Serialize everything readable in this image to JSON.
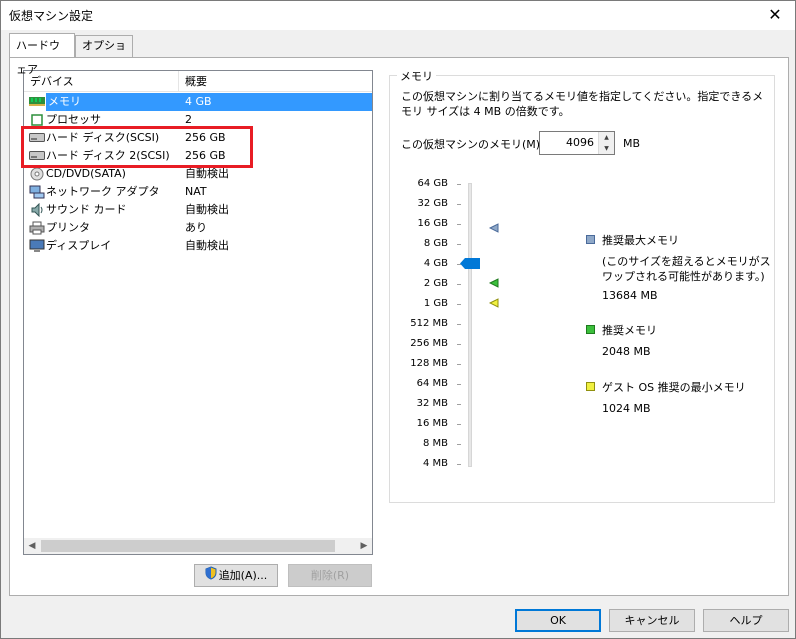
{
  "window": {
    "title": "仮想マシン設定",
    "close_glyph": "✕"
  },
  "tabs": [
    {
      "label": "ハードウェア",
      "active": true
    },
    {
      "label": "オプション",
      "active": false
    }
  ],
  "device_list": {
    "headers": {
      "device": "デバイス",
      "summary": "概要"
    },
    "rows": [
      {
        "icon": "memory-icon",
        "name": "メモリ",
        "value": "4 GB",
        "selected": true
      },
      {
        "icon": "processor-icon",
        "name": "プロセッサ",
        "value": "2",
        "selected": false
      },
      {
        "icon": "hard-disk-icon",
        "name": "ハード ディスク(SCSI)",
        "value": "256 GB",
        "selected": false
      },
      {
        "icon": "hard-disk-icon",
        "name": "ハード ディスク 2(SCSI)",
        "value": "256 GB",
        "selected": false
      },
      {
        "icon": "cd-dvd-icon",
        "name": "CD/DVD(SATA)",
        "value": "自動検出",
        "selected": false
      },
      {
        "icon": "network-adapter-icon",
        "name": "ネットワーク アダプタ",
        "value": "NAT",
        "selected": false
      },
      {
        "icon": "sound-card-icon",
        "name": "サウンド カード",
        "value": "自動検出",
        "selected": false
      },
      {
        "icon": "printer-icon",
        "name": "プリンタ",
        "value": "あり",
        "selected": false
      },
      {
        "icon": "display-icon",
        "name": "ディスプレイ",
        "value": "自動検出",
        "selected": false
      }
    ]
  },
  "buttons": {
    "add": "追加(A)...",
    "remove": "削除(R)",
    "ok": "OK",
    "cancel": "キャンセル",
    "help": "ヘルプ"
  },
  "memory": {
    "group_title": "メモリ",
    "description": "この仮想マシンに割り当てるメモリ値を指定してください。指定できるメモリ サイズは 4 MB の倍数です。",
    "field_label": "この仮想マシンのメモリ(M):",
    "value": "4096",
    "unit": "MB",
    "scale_labels": [
      "64 GB",
      "32 GB",
      "16 GB",
      "8 GB",
      "4 GB",
      "2 GB",
      "1 GB",
      "512 MB",
      "256 MB",
      "128 MB",
      "64 MB",
      "32 MB",
      "16 MB",
      "8 MB",
      "4 MB"
    ],
    "legend": {
      "max": {
        "label": "推奨最大メモリ",
        "note": "(このサイズを超えるとメモリがスワップされる可能性があります。)",
        "value": "13684 MB",
        "color": "#8fa8c8"
      },
      "recommended": {
        "label": "推奨メモリ",
        "value": "2048 MB",
        "color": "#3cbf3c"
      },
      "guest_min": {
        "label": "ゲスト OS 推奨の最小メモリ",
        "value": "1024 MB",
        "color": "#f0f040"
      }
    },
    "slider_color": "#0078d7"
  }
}
